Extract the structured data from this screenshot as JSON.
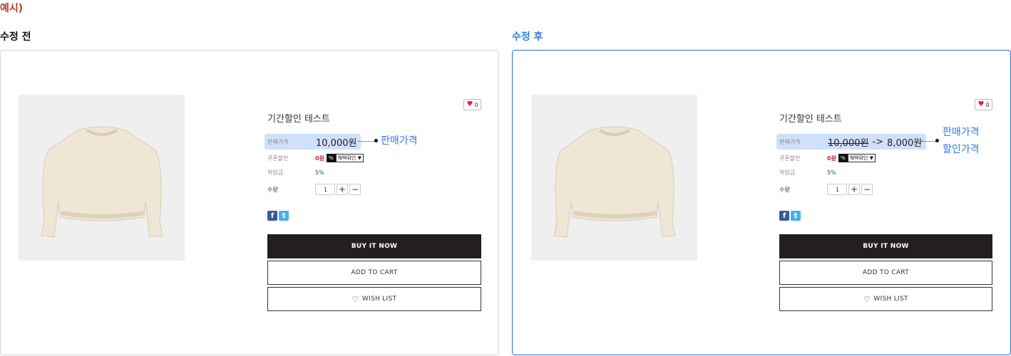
{
  "example_label": "예시)",
  "before": {
    "title": "수정 전",
    "like_count": "0",
    "product_name": "기간할인 테스트",
    "price_label": "판매가격",
    "price": "10,000원",
    "callout": "판매가격",
    "coupon_label": "쿠폰할인",
    "coupon_value": "0원",
    "coupon_badge": "%",
    "coupon_select": "혜택확인 ▼",
    "points_label": "적립금",
    "points_value": "5%",
    "qty_label": "수량",
    "qty_value": "1",
    "qty_plus": "+",
    "qty_minus": "−",
    "buy_label": "BUY IT NOW",
    "cart_label": "ADD TO CART",
    "wish_label": "WISH LIST"
  },
  "after": {
    "title": "수정 후",
    "like_count": "0",
    "product_name": "기간할인 테스트",
    "price_label": "판매가격",
    "price_old": "10,000원",
    "price_arrow": "->",
    "price_new": "8,000원",
    "callout_line1": "판매가격",
    "callout_line2": "할인가격",
    "coupon_label": "쿠폰할인",
    "coupon_value": "0원",
    "coupon_badge": "%",
    "coupon_select": "혜택확인 ▼",
    "points_label": "적립금",
    "points_value": "5%",
    "qty_label": "수량",
    "qty_value": "1",
    "qty_plus": "+",
    "qty_minus": "−",
    "buy_label": "BUY IT NOW",
    "cart_label": "ADD TO CART",
    "wish_label": "WISH LIST"
  },
  "icons": {
    "heart": "♥",
    "heart_outline": "♡",
    "facebook": "f",
    "twitter": "t"
  },
  "colors": {
    "accent_blue": "#2f7de1",
    "example_red": "#c0392b",
    "price_highlight": "#cfe0fb",
    "buy_button": "#231f20"
  }
}
